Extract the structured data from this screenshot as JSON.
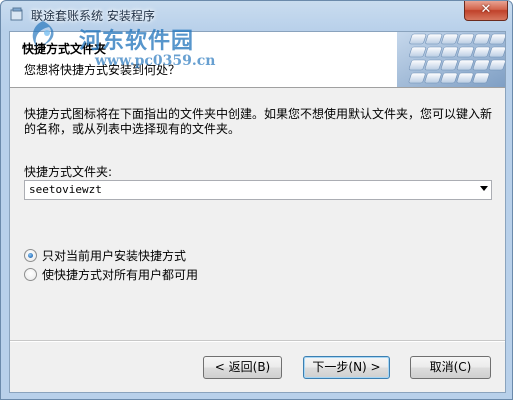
{
  "window": {
    "title": "联途套账系统 安装程序",
    "close_symbol": "✕",
    "accent_color": "#1f66b3",
    "close_color": "#c0412a"
  },
  "watermark": {
    "title": "河东软件园",
    "url": "www.pc0359.cn"
  },
  "header": {
    "title": "快捷方式文件夹",
    "subtitle": "您想将快捷方式安装到何处？"
  },
  "body": {
    "description": "快捷方式图标将在下面指出的文件夹中创建。如果您不想使用默认文件夹，您可以键入新的名称，或从列表中选择现有的文件夹。",
    "folder_label": "快捷方式文件夹:",
    "folder_value": "seetoviewzt"
  },
  "options": {
    "current_user": "只对当前用户安装快捷方式",
    "all_users": "使快捷方式对所有用户都可用",
    "selected": "current_user"
  },
  "buttons": {
    "back": "< 返回(B)",
    "next": "下一步(N) >",
    "cancel": "取消(C)"
  }
}
